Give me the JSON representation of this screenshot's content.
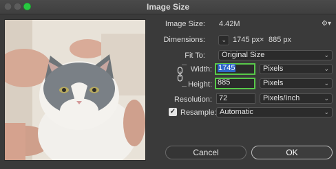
{
  "window": {
    "title": "Image Size"
  },
  "image_size": {
    "label": "Image Size:",
    "value": "4.42M"
  },
  "dimensions": {
    "label": "Dimensions:",
    "width": "1745 px",
    "times": "×",
    "height": "885 px"
  },
  "fit_to": {
    "label": "Fit To:",
    "value": "Original Size"
  },
  "width": {
    "label": "Width:",
    "value": "1745",
    "unit": "Pixels"
  },
  "height": {
    "label": "Height:",
    "value": "885",
    "unit": "Pixels"
  },
  "resolution": {
    "label": "Resolution:",
    "value": "72",
    "unit": "Pixels/Inch"
  },
  "resample": {
    "label": "Resample:",
    "value": "Automatic",
    "checked": true
  },
  "buttons": {
    "cancel": "Cancel",
    "ok": "OK"
  },
  "colors": {
    "highlight_border": "#58c94a",
    "selection": "#2f67c9",
    "dialog_bg": "#3a3a3a"
  }
}
